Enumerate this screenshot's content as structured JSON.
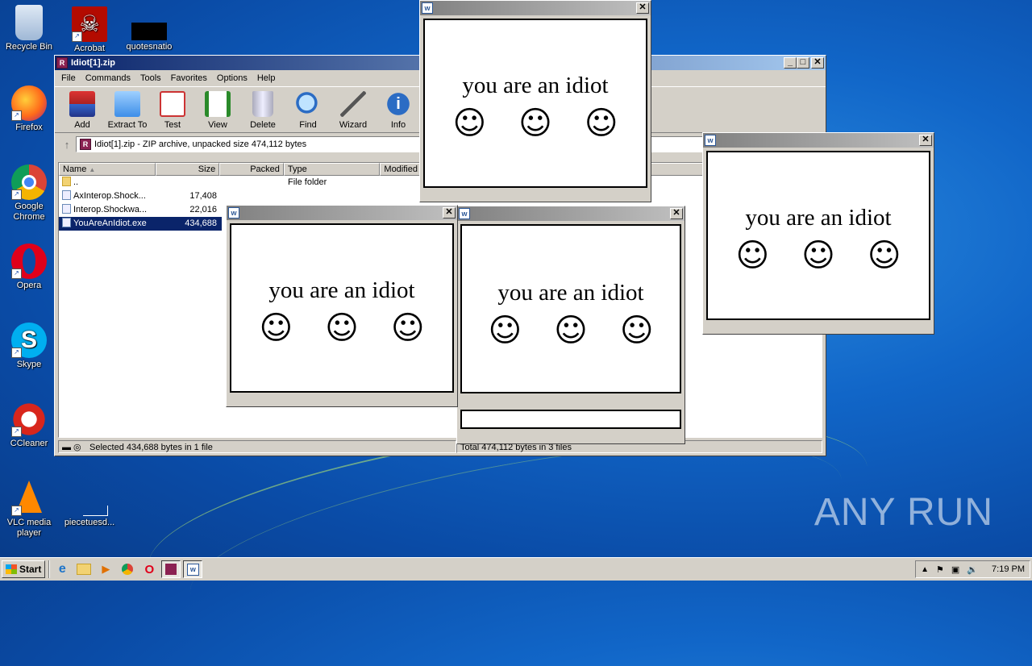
{
  "desktop": {
    "icons": [
      {
        "label": "Recycle Bin"
      },
      {
        "label": "Acrobat"
      },
      {
        "label": "quotesnatio"
      },
      {
        "label": "Firefox"
      },
      {
        "label": "Google Chrome"
      },
      {
        "label": "Opera"
      },
      {
        "label": "Skype"
      },
      {
        "label": "CCleaner"
      },
      {
        "label": "VLC media player"
      },
      {
        "label": "piecetuesd..."
      }
    ],
    "watermark": "ANY RUN"
  },
  "winrar": {
    "title": "Idiot[1].zip",
    "menu": [
      "File",
      "Commands",
      "Tools",
      "Favorites",
      "Options",
      "Help"
    ],
    "tools": [
      "Add",
      "Extract To",
      "Test",
      "View",
      "Delete",
      "Find",
      "Wizard",
      "Info"
    ],
    "path": "Idiot[1].zip - ZIP archive, unpacked size 474,112 bytes",
    "columns": {
      "name": "Name",
      "size": "Size",
      "packed": "Packed",
      "type": "Type",
      "modified": "Modified"
    },
    "rows": [
      {
        "name": "..",
        "size": "",
        "type": "File folder"
      },
      {
        "name": "AxInterop.Shock...",
        "size": "17,408",
        "type": ""
      },
      {
        "name": "Interop.Shockwa...",
        "size": "22,016",
        "type": ""
      },
      {
        "name": "YouAreAnIdiot.exe",
        "size": "434,688",
        "type": ""
      }
    ],
    "status_left": "Selected 434,688 bytes in 1 file",
    "status_right": "Total 474,112 bytes in 3 files"
  },
  "popup": {
    "text": "you are an idiot",
    "smiley": "☺"
  },
  "taskbar": {
    "start": "Start",
    "clock": "7:19 PM"
  },
  "colors": {
    "title_active": "#0a246a",
    "selection": "#0a246a"
  }
}
